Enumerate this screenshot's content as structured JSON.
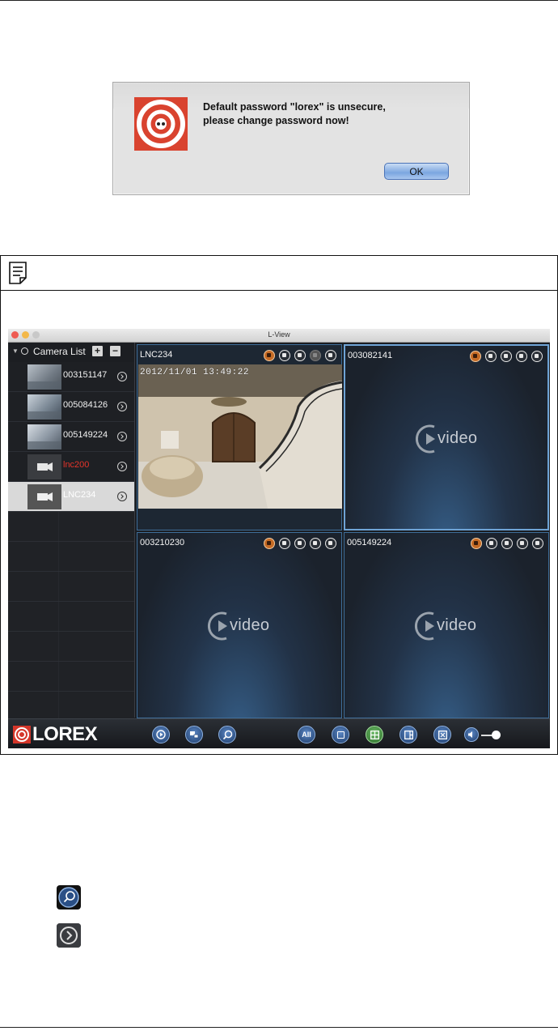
{
  "dialog": {
    "message_line1": "Default password \"lorex\" is unsecure,",
    "message_line2": "please change password now!",
    "ok_label": "OK"
  },
  "lview": {
    "window_title": "L-View",
    "camera_list_title": "Camera List",
    "add_label": "+",
    "remove_label": "−",
    "cameras": [
      {
        "name": "003151147",
        "status": "online"
      },
      {
        "name": "005084126",
        "status": "online"
      },
      {
        "name": "005149224",
        "status": "online"
      },
      {
        "name": "lnc200",
        "status": "offline"
      },
      {
        "name": "LNC234",
        "status": "selected"
      }
    ],
    "panels": [
      {
        "label": "LNC234",
        "timestamp": "2012/11/01 13:49:22"
      },
      {
        "label": "003082141",
        "placeholder": "video"
      },
      {
        "label": "003210230",
        "placeholder": "video"
      },
      {
        "label": "005149224",
        "placeholder": "video"
      }
    ],
    "brand": "LOREX",
    "toolbar_all_label": "All"
  },
  "colors": {
    "brand_red": "#d4362a",
    "offline_red": "#e6342a",
    "panel_border": "#6fa4d6",
    "button_blue": "#5b87c4",
    "button_green": "#6fbf6a"
  }
}
